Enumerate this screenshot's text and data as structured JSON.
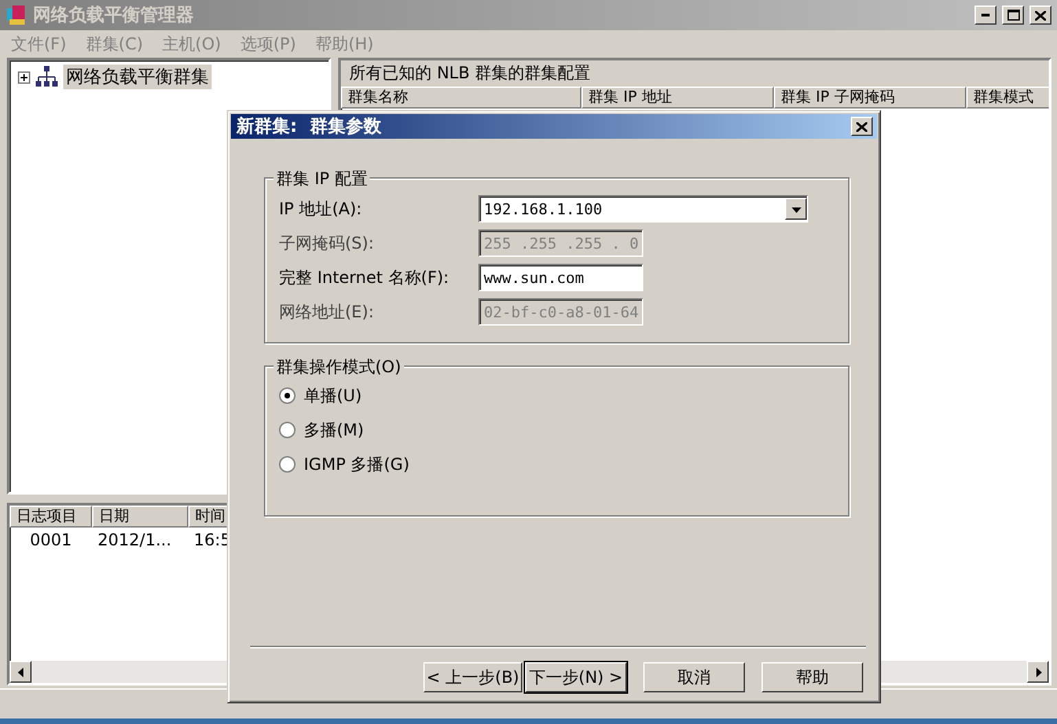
{
  "window": {
    "title": "网络负载平衡管理器"
  },
  "menu": [
    {
      "label": "文件(F)"
    },
    {
      "label": "群集(C)"
    },
    {
      "label": "主机(O)"
    },
    {
      "label": "选项(P)"
    },
    {
      "label": "帮助(H)"
    }
  ],
  "tree": {
    "items": [
      {
        "label": "网络负载平衡群集",
        "expanded": false,
        "selected": true
      }
    ]
  },
  "cluster_list": {
    "caption": "所有已知的 NLB 群集的群集配置",
    "columns": [
      "群集名称",
      "群集 IP 地址",
      "群集 IP 子网掩码",
      "群集模式"
    ]
  },
  "log": {
    "columns": [
      "日志项目",
      "日期",
      "时间"
    ],
    "rows": [
      [
        "0001",
        "2012/1...",
        "16:5"
      ]
    ]
  },
  "dialog": {
    "title": "新群集:  群集参数",
    "ip_group": {
      "title": "群集 IP 配置",
      "fields": [
        {
          "label": "IP 地址(A):",
          "value": "192.168.1.100",
          "kind": "dropdown",
          "disabled": false
        },
        {
          "label": "子网掩码(S):",
          "value": "255 .255 .255 . 0",
          "kind": "text",
          "disabled": true
        },
        {
          "label": "完整 Internet 名称(F):",
          "value": "www.sun.com",
          "kind": "text",
          "disabled": false
        },
        {
          "label": "网络地址(E):",
          "value": "02-bf-c0-a8-01-64",
          "kind": "text",
          "disabled": true
        }
      ]
    },
    "mode_group": {
      "title": "群集操作模式(O)",
      "options": [
        {
          "label": "单播(U)",
          "selected": true
        },
        {
          "label": "多播(M)",
          "selected": false
        },
        {
          "label": "IGMP 多播(G)",
          "selected": false
        }
      ]
    },
    "buttons": [
      {
        "label": "< 上一步(B)",
        "default": false
      },
      {
        "label": "下一步(N) >",
        "default": true
      },
      {
        "label": "取消",
        "default": false
      },
      {
        "label": "帮助",
        "default": false
      }
    ]
  }
}
